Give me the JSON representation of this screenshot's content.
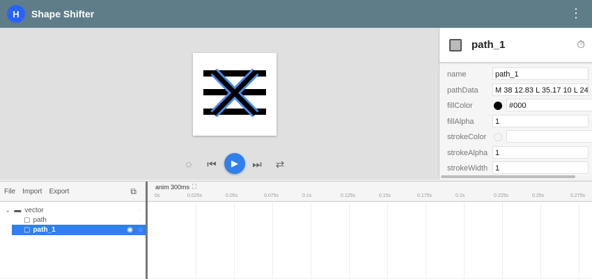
{
  "toolbar": {
    "title": "Shape Shifter",
    "logo": "H"
  },
  "canvas": {
    "controls": [
      "speed-icon",
      "skip-previous-icon",
      "play-icon",
      "skip-next-icon",
      "repeat-icon"
    ]
  },
  "properties": {
    "title": "path_1",
    "rows": [
      {
        "label": "name",
        "value": "path_1"
      },
      {
        "label": "pathData",
        "value": "M 38 12.83 L 35.17 10 L 24"
      },
      {
        "label": "fillColor",
        "value": "#000",
        "swatch": "#000000"
      },
      {
        "label": "fillAlpha",
        "value": "1"
      },
      {
        "label": "strokeColor",
        "value": "",
        "swatch": "transparent"
      },
      {
        "label": "strokeAlpha",
        "value": "1"
      },
      {
        "label": "strokeWidth",
        "value": "1"
      }
    ]
  },
  "layers": {
    "menu": [
      "File",
      "Import",
      "Export"
    ],
    "items": [
      {
        "label": "vector"
      },
      {
        "label": "path"
      },
      {
        "label": "path_1"
      }
    ]
  },
  "timeline": {
    "title": "anim 300ms",
    "ticks": [
      "0s",
      "0.025s",
      "0.05s",
      "0.075s",
      "0.1s",
      "0.125s",
      "0.15s",
      "0.175s",
      "0.2s",
      "0.225s",
      "0.25s",
      "0.275s"
    ]
  },
  "colors": {
    "accent": "#2f80ed",
    "toolbar": "#5f7d88"
  }
}
